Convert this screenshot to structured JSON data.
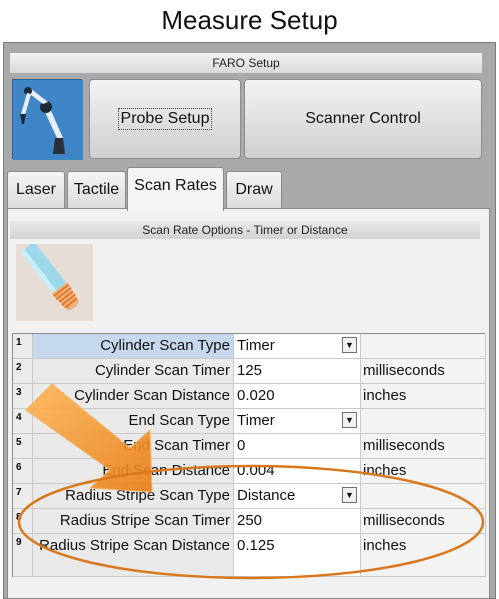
{
  "window": {
    "title": "Measure Setup"
  },
  "faro": {
    "header": "FARO Setup",
    "probe_setup_label": "Probe Setup",
    "scanner_control_label": "Scanner Control"
  },
  "tabs": [
    {
      "label": "Laser",
      "active": false
    },
    {
      "label": "Tactile",
      "active": false
    },
    {
      "label": "Scan Rates",
      "active": true
    },
    {
      "label": "Draw",
      "active": false
    }
  ],
  "scan_rates": {
    "header": "Scan Rate Options - Timer or Distance",
    "rows": [
      {
        "num": "1",
        "label": "Cylinder Scan Type",
        "value": "Timer",
        "unit": "",
        "dropdown": true
      },
      {
        "num": "2",
        "label": "Cylinder Scan Timer",
        "value": "125",
        "unit": "milliseconds",
        "dropdown": false
      },
      {
        "num": "3",
        "label": "Cylinder Scan Distance",
        "value": "0.020",
        "unit": "inches",
        "dropdown": false
      },
      {
        "num": "4",
        "label": "End Scan Type",
        "value": "Timer",
        "unit": "",
        "dropdown": true
      },
      {
        "num": "5",
        "label": "End Scan Timer",
        "value": "0",
        "unit": "milliseconds",
        "dropdown": false
      },
      {
        "num": "6",
        "label": "End Scan Distance",
        "value": "0.004",
        "unit": "inches",
        "dropdown": false
      },
      {
        "num": "7",
        "label": "Radius Stripe Scan Type",
        "value": "Distance",
        "unit": "",
        "dropdown": true
      },
      {
        "num": "8",
        "label": "Radius Stripe Scan Timer",
        "value": "250",
        "unit": "milliseconds",
        "dropdown": false
      },
      {
        "num": "9",
        "label": "Radius Stripe Scan Distance",
        "value": "0.125",
        "unit": "inches",
        "dropdown": false
      }
    ]
  },
  "icons": {
    "dropdown": "chevron-down-icon",
    "probe": "faro-arm-icon",
    "thumbnail": "probe-tip-icon",
    "annotation": "arrow-annotation"
  },
  "colors": {
    "selected_row": "#c6d8ee",
    "arrow": "#f0901e",
    "ellipse": "#d9771c"
  }
}
